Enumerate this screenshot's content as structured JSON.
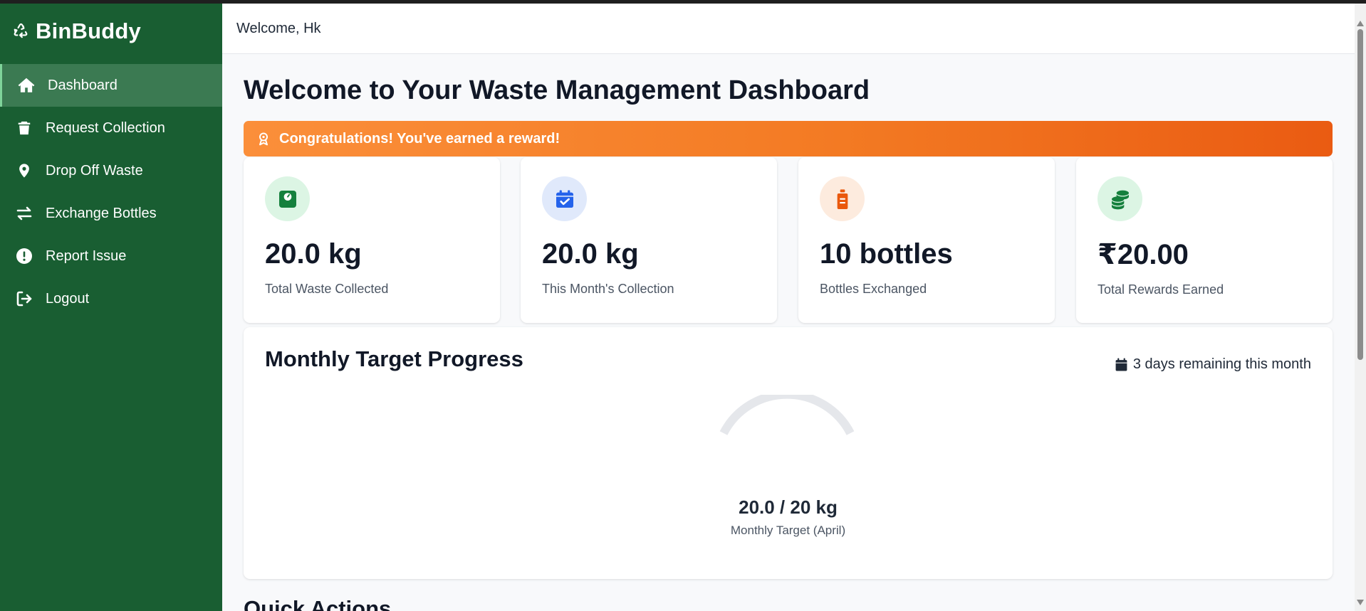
{
  "app": {
    "name": "BinBuddy"
  },
  "sidebar": {
    "items": [
      {
        "label": "Dashboard",
        "icon": "home-icon",
        "active": true
      },
      {
        "label": "Request Collection",
        "icon": "trash-icon"
      },
      {
        "label": "Drop Off Waste",
        "icon": "location-pin-icon"
      },
      {
        "label": "Exchange Bottles",
        "icon": "exchange-arrows-icon"
      },
      {
        "label": "Report Issue",
        "icon": "alert-circle-icon"
      },
      {
        "label": "Logout",
        "icon": "logout-icon"
      }
    ]
  },
  "header": {
    "welcome": "Welcome, Hk"
  },
  "main": {
    "title": "Welcome to Your Waste Management Dashboard",
    "banner": "Congratulations! You've earned a reward!",
    "stats": [
      {
        "value": "20.0 kg",
        "label": "Total Waste Collected",
        "icon": "weight-scale-icon"
      },
      {
        "value": "20.0 kg",
        "label": "This Month's Collection",
        "icon": "calendar-check-icon"
      },
      {
        "value": "10 bottles",
        "label": "Bottles Exchanged",
        "icon": "bottle-icon"
      },
      {
        "value": "₹20.00",
        "label": "Total Rewards Earned",
        "icon": "coins-icon"
      }
    ],
    "progress": {
      "title": "Monthly Target Progress",
      "days_remaining": "3 days remaining this month",
      "value_text": "20.0 / 20 kg",
      "label": "Monthly Target (April)",
      "current": 20.0,
      "target": 20
    },
    "quick_actions_title": "Quick Actions"
  },
  "colors": {
    "sidebar_bg": "#195e32",
    "sidebar_active": "#3b7a52",
    "banner_start": "#fb8f3a",
    "banner_end": "#ea5b12",
    "green_accent": "#15803d",
    "blue_accent": "#2563eb",
    "orange_accent": "#ea580c"
  }
}
